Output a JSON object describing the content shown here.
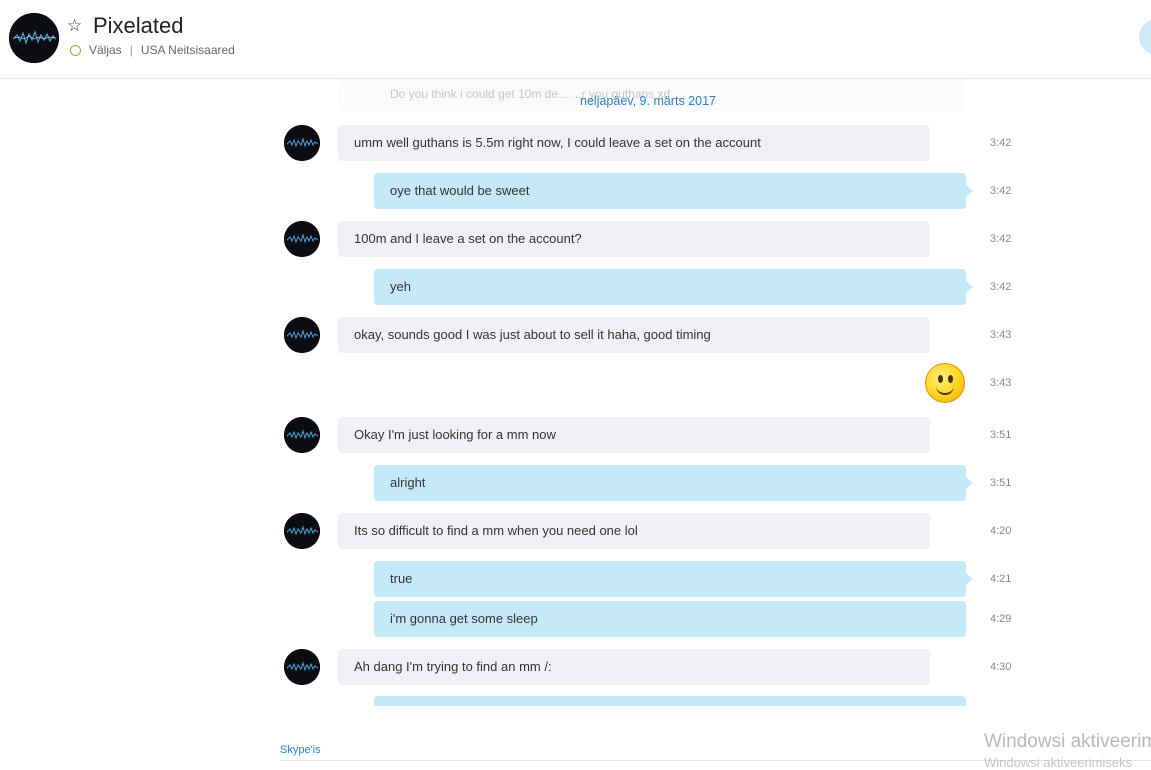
{
  "header": {
    "title": "Pixelated",
    "status": "Väljas",
    "location": "USA Neitsisaared",
    "separator": "|"
  },
  "icons": {
    "favorite": "star-outline-icon",
    "presence": "presence-away-icon",
    "emoticon": "smile-emoticon-icon"
  },
  "colors": {
    "incoming_bubble": "#eff1f4",
    "outgoing_bubble": "#c6e9f9",
    "link": "#2f7fc1",
    "presence": "#7cbd2a"
  },
  "conversation": {
    "previous_message_partial": "Do you think i could get 10m de... ...r you guthans xd",
    "date_separator": "neljapäev, 9. märts 2017",
    "messages": [
      {
        "from": "them",
        "text": "umm well guthans is 5.5m right now, I could leave a set on the account",
        "time": "3:42"
      },
      {
        "from": "me",
        "text": "oye that would be sweet",
        "time": "3:42"
      },
      {
        "from": "them",
        "text": "100m and I leave a set on the account?",
        "time": "3:42"
      },
      {
        "from": "me",
        "text": "yeh",
        "time": "3:42"
      },
      {
        "from": "them",
        "text": "okay, sounds good I was just about to sell it haha, good timing",
        "time": "3:43"
      },
      {
        "from": "me",
        "emoticon": "smile",
        "time": "3:43"
      },
      {
        "from": "them",
        "text": "Okay I'm just looking for a mm now",
        "time": "3:51"
      },
      {
        "from": "me",
        "text": "alright",
        "time": "3:51"
      },
      {
        "from": "them",
        "text": "Its so difficult to find a mm when you need one lol",
        "time": "4:20"
      },
      {
        "from": "me",
        "text": "true",
        "time": "4:21"
      },
      {
        "from": "me",
        "text": "i'm gonna get some sleep",
        "time": "4:29"
      },
      {
        "from": "them",
        "text": "Ah dang I'm trying to find an mm /:",
        "time": "4:30"
      }
    ]
  },
  "footer": {
    "link": "Skype'is",
    "watermark_title": "Windowsi aktiveerimine",
    "watermark_sub": "Windowsi aktiveerimiseks"
  }
}
